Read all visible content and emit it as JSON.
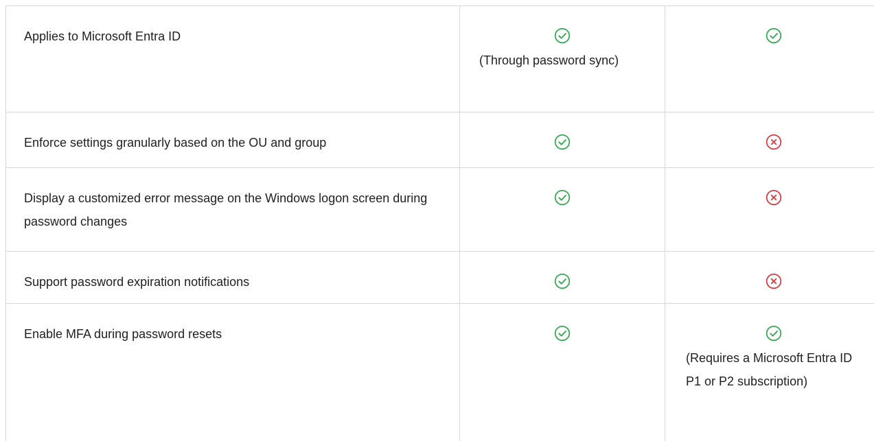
{
  "colors": {
    "check": "#2fa84f",
    "cross": "#d9363e",
    "border": "#d6d6d6",
    "text": "#1f1f1f"
  },
  "rows": [
    {
      "feature": "Applies to Microsoft Entra ID",
      "col_a": {
        "icon": "check-circle-icon",
        "note": "(Through password sync)"
      },
      "col_b": {
        "icon": "check-circle-icon",
        "note": ""
      }
    },
    {
      "feature": "Enforce settings granularly based on the OU and group",
      "col_a": {
        "icon": "check-circle-icon",
        "note": ""
      },
      "col_b": {
        "icon": "x-circle-icon",
        "note": ""
      }
    },
    {
      "feature": "Display a customized error message on the Windows logon screen during password changes",
      "col_a": {
        "icon": "check-circle-icon",
        "note": ""
      },
      "col_b": {
        "icon": "x-circle-icon",
        "note": ""
      }
    },
    {
      "feature": "Support password expiration notifications",
      "col_a": {
        "icon": "check-circle-icon",
        "note": ""
      },
      "col_b": {
        "icon": "x-circle-icon",
        "note": ""
      }
    },
    {
      "feature": "Enable MFA during password resets",
      "col_a": {
        "icon": "check-circle-icon",
        "note": ""
      },
      "col_b": {
        "icon": "check-circle-icon",
        "note": "(Requires a Microsoft Entra ID P1 or P2 subscription)"
      }
    }
  ]
}
